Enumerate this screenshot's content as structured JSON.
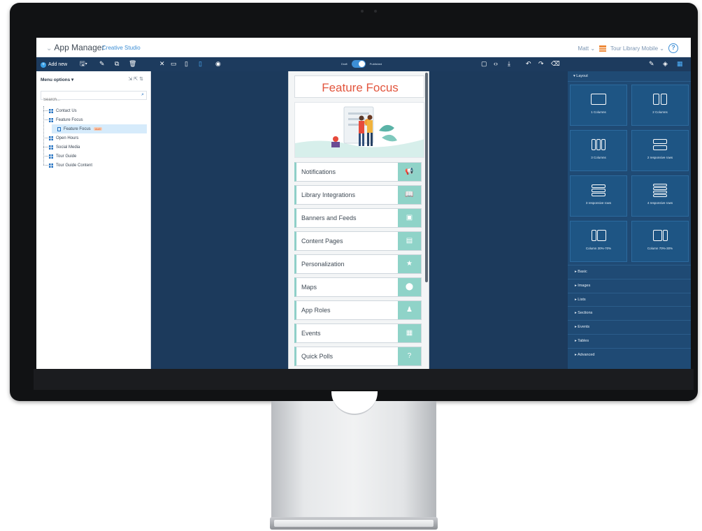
{
  "app": {
    "title": "App Manager",
    "subtitle": "Creative Studio",
    "user": "Matt",
    "library": "Tour Library Mobile",
    "help_icon": "help-icon"
  },
  "toolbar": {
    "add_new": "Add new",
    "toggle_left": "Draft",
    "toggle_right": "Published"
  },
  "left_panel": {
    "menu_options": "Menu options",
    "search_placeholder": "Search...",
    "tree": [
      {
        "label": "Contact Us"
      },
      {
        "label": "Feature Focus"
      },
      {
        "label": "Feature Focus",
        "badge": "draft",
        "child": true
      },
      {
        "label": "Open Hours"
      },
      {
        "label": "Social Media"
      },
      {
        "label": "Tour Guide"
      },
      {
        "label": "Tour Guide Content"
      }
    ]
  },
  "phone": {
    "title": "Feature Focus",
    "items": [
      {
        "label": "Notifications",
        "icon": "megaphone-icon"
      },
      {
        "label": "Library Integrations",
        "icon": "book-icon"
      },
      {
        "label": "Banners and Feeds",
        "icon": "images-icon"
      },
      {
        "label": "Content Pages",
        "icon": "document-icon"
      },
      {
        "label": "Personalization",
        "icon": "star-icon"
      },
      {
        "label": "Maps",
        "icon": "map-pin-icon"
      },
      {
        "label": "App Roles",
        "icon": "user-icon"
      },
      {
        "label": "Events",
        "icon": "calendar-icon"
      },
      {
        "label": "Quick Polls",
        "icon": "question-icon"
      }
    ]
  },
  "right_panel": {
    "layout_header": "Layout",
    "tiles": [
      {
        "label": "1 Columns"
      },
      {
        "label": "2 Columns"
      },
      {
        "label": "3 Columns"
      },
      {
        "label": "2 responsive rows"
      },
      {
        "label": "3 responsive rows"
      },
      {
        "label": "4 responsive rows"
      },
      {
        "label": "Column 30%-70%"
      },
      {
        "label": "Column 70%-30%"
      }
    ],
    "sections": [
      "Basic",
      "Images",
      "Lists",
      "Sections",
      "Events",
      "Tables",
      "Advanced"
    ]
  }
}
